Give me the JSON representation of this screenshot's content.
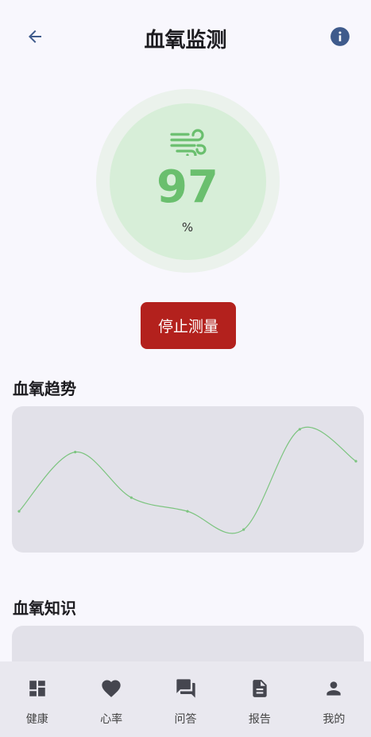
{
  "header": {
    "title": "血氧监测",
    "back_icon": "arrow-back-icon",
    "info_icon": "info-icon"
  },
  "gauge": {
    "icon": "wind-icon",
    "value": "97",
    "unit": "%",
    "color": "#6abf6e"
  },
  "actions": {
    "stop_label": "停止测量",
    "stop_color": "#b3211d"
  },
  "trend": {
    "title": "血氧趋势"
  },
  "knowledge": {
    "title": "血氧知识"
  },
  "chart_data": {
    "type": "line",
    "title": "",
    "xlabel": "",
    "ylabel": "",
    "x": [
      0,
      1,
      2,
      3,
      4,
      5,
      6
    ],
    "values": [
      96.3,
      97.6,
      96.6,
      96.3,
      95.9,
      98.1,
      97.4
    ],
    "ylim": [
      95.5,
      98.5
    ],
    "line_color": "#7cc47f",
    "grid": false
  },
  "bottom_nav": [
    {
      "label": "健康",
      "icon": "dashboard-icon"
    },
    {
      "label": "心率",
      "icon": "heart-icon"
    },
    {
      "label": "问答",
      "icon": "chat-icon"
    },
    {
      "label": "报告",
      "icon": "document-icon"
    },
    {
      "label": "我的",
      "icon": "person-icon"
    }
  ]
}
